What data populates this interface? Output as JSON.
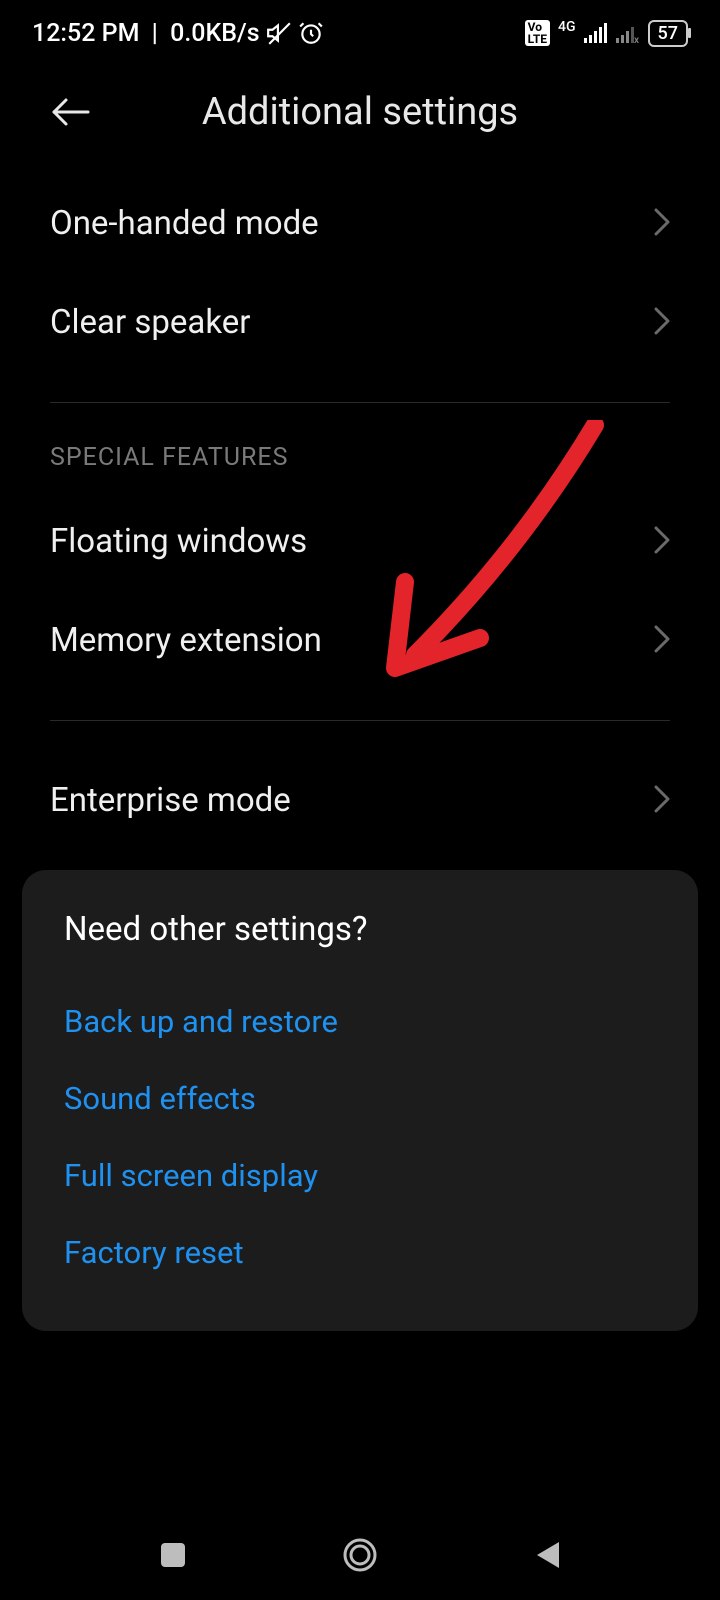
{
  "status": {
    "time": "12:52 PM",
    "data_rate": "0.0KB/s",
    "network_type": "4G",
    "battery": "57"
  },
  "header": {
    "title": "Additional settings"
  },
  "items": {
    "one_handed": "One-handed mode",
    "clear_speaker": "Clear speaker",
    "floating_windows": "Floating windows",
    "memory_extension": "Memory extension",
    "enterprise_mode": "Enterprise mode"
  },
  "section": {
    "special_features": "SPECIAL FEATURES"
  },
  "suggestions": {
    "title": "Need other settings?",
    "backup": "Back up and restore",
    "sound": "Sound effects",
    "fullscreen": "Full screen display",
    "factory_reset": "Factory reset"
  }
}
